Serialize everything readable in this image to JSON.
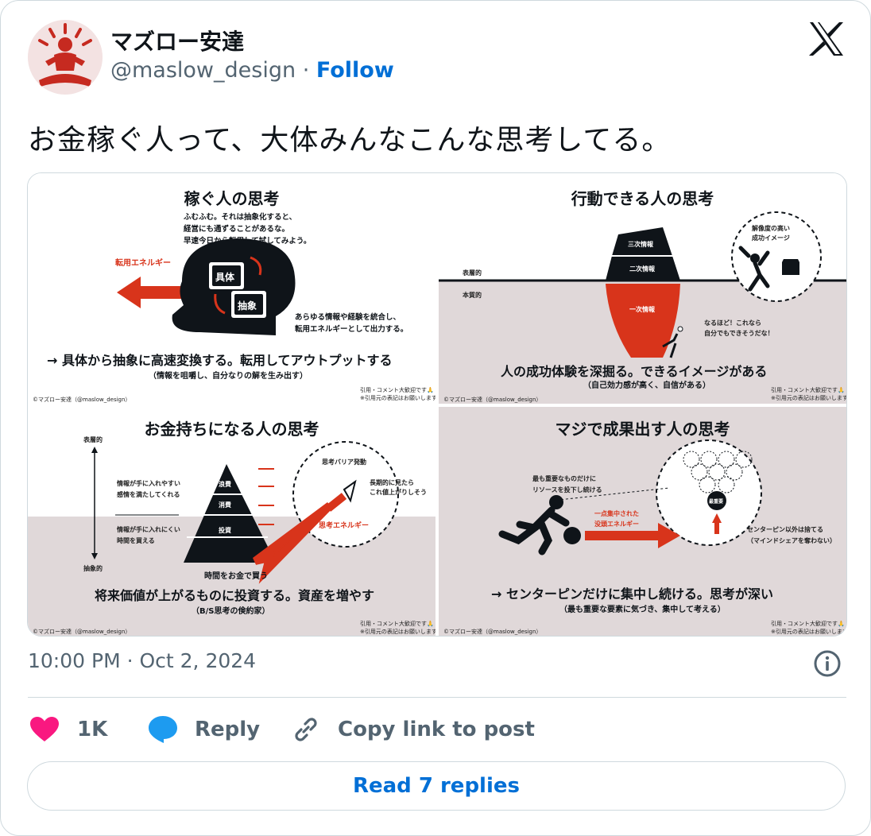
{
  "author": {
    "name": "マズロー安達",
    "handle": "@maslow_design",
    "separator": "·",
    "follow_label": "Follow"
  },
  "tweet": {
    "text": "お金稼ぐ人って、大体みんなこんな思考してる。"
  },
  "media": {
    "panel1": {
      "title": "稼ぐ人の思考",
      "note": [
        "ふむふむ。それは抽象化すると、",
        "経営にも通ずることがあるな。",
        "早速今日から転用して試してみよう。"
      ],
      "arrow_label": "転用エネルギー",
      "box1": "具体",
      "box2": "抽象",
      "side_note": [
        "あらゆる情報や経験を統合し、",
        "転用エネルギーとして出力する。"
      ],
      "main": "→ 具体から抽象に高速変換する。転用してアウトプットする",
      "sub": "（情報を咀嚼し、自分なりの解を生み出す）",
      "credit": "©マズロー安達（@maslow_design）",
      "notice": [
        "引用・コメント大歓迎です🙏",
        "※引用元の表記はお願いします"
      ]
    },
    "panel2": {
      "title": "行動できる人の思考",
      "surface": "表層的",
      "essence": "本質的",
      "layer3": "三次情報",
      "layer2": "二次情報",
      "layer1": "一次情報",
      "bubble": [
        "解像度の高い",
        "成功イメージ"
      ],
      "thought": [
        "なるほど！これなら",
        "自分でもできそうだな！"
      ],
      "main": "人の成功体験を深掘る。できるイメージがある",
      "sub": "（自己効力感が高く、自信がある）",
      "credit": "©マズロー安達（@maslow_design）",
      "notice": [
        "引用・コメント大歓迎です🙏",
        "※引用元の表記はお願いします"
      ]
    },
    "panel3": {
      "title": "お金持ちになる人の思考",
      "surface": "表層的",
      "abstract": "抽象的",
      "left_top": [
        "情報が手に入れやすい",
        "感情を満たしてくれる"
      ],
      "left_bottom": [
        "情報が手に入れにくい",
        "時間を買える"
      ],
      "tier1": "浪費",
      "tier2": "消費",
      "tier3": "投資",
      "bubble_top": "思考バリア発動",
      "bubble_mid": [
        "長期的に見たら",
        "これ値上がりしそう"
      ],
      "bubble_energy": "思考エネルギー",
      "under": "時間をお金で買う",
      "main": "将来価値が上がるものに投資する。資産を増やす",
      "sub": "（B/S思考の倹約家）",
      "credit": "©マズロー安達（@maslow_design）",
      "notice": [
        "引用・コメント大歓迎です🙏",
        "※引用元の表記はお願いします"
      ]
    },
    "panel4": {
      "title": "マジで成果出す人の思考",
      "note": [
        "最も重要なものだけに",
        "リソースを投下し続ける"
      ],
      "energy": [
        "一点集中された",
        "没頭エネルギー"
      ],
      "pin_label": "最重要",
      "pin_note": [
        "センターピン以外は捨てる",
        "（マインドシェアを奪わない）"
      ],
      "main": "→ センターピンだけに集中し続ける。思考が深い",
      "sub": "（最も重要な要素に気づき、集中して考える）",
      "credit": "©マズロー安達（@maslow_design）",
      "notice": [
        "引用・コメント大歓迎です🙏",
        "※引用元の表記はお願いします"
      ]
    }
  },
  "meta": {
    "time": "10:00 PM · Oct 2, 2024"
  },
  "actions": {
    "likes": "1K",
    "reply": "Reply",
    "copy": "Copy link to post",
    "read_replies": "Read 7 replies"
  },
  "icons": {
    "avatar": "meditation-avatar-icon",
    "brand": "x-logo-icon",
    "info": "info-icon",
    "like": "heart-icon",
    "reply": "speech-bubble-icon",
    "copy": "link-icon"
  },
  "colors": {
    "accent": "#006fd6",
    "like": "#f91880",
    "muted": "#536471",
    "accent_red": "#d8341b",
    "reply_icon": "#1d9bf0"
  }
}
